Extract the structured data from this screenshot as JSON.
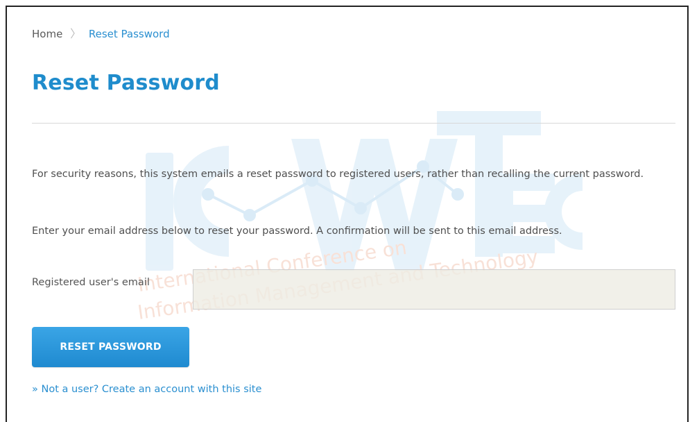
{
  "breadcrumb": {
    "home": "Home",
    "separator": "〉",
    "current": "Reset Password"
  },
  "page": {
    "title": "Reset Password",
    "para1": "For security reasons, this system emails a reset password to registered users, rather than recalling the current password.",
    "para2": "Enter your email address below to reset your password. A confirmation will be sent to this email address."
  },
  "form": {
    "email_label": "Registered user's email",
    "email_value": "",
    "submit_label": "RESET PASSWORD"
  },
  "links": {
    "create_account": "» Not a user? Create an account with this site"
  },
  "watermark": {
    "line1": "International Conference on",
    "line2": "Information Management and Technology",
    "logo": "ICIMTECH"
  },
  "colors": {
    "accent": "#1f8ccc",
    "link": "#2a8fd0",
    "input_bg": "#eeece3"
  }
}
